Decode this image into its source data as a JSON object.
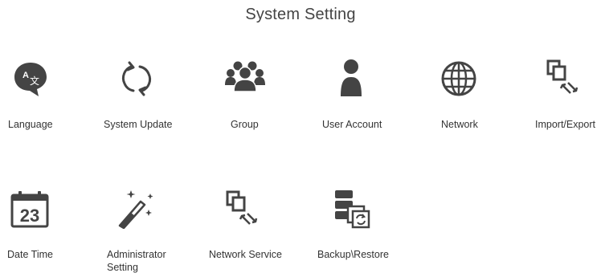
{
  "page_title": "System Setting",
  "icon_color": "#444444",
  "tiles": [
    {
      "label": "Language",
      "icon": "language-icon"
    },
    {
      "label": "System Update",
      "icon": "sync-icon"
    },
    {
      "label": "Group",
      "icon": "group-icon"
    },
    {
      "label": "User Account",
      "icon": "user-icon"
    },
    {
      "label": "Network",
      "icon": "globe-icon"
    },
    {
      "label": "Import/Export",
      "icon": "import-export-icon"
    },
    {
      "label": "Date Time",
      "icon": "calendar-icon",
      "day": "23"
    },
    {
      "label": "Administrator Setting",
      "icon": "magic-wand-icon"
    },
    {
      "label": "Network Service",
      "icon": "network-service-icon"
    },
    {
      "label": "Backup\\Restore",
      "icon": "backup-restore-icon"
    }
  ]
}
